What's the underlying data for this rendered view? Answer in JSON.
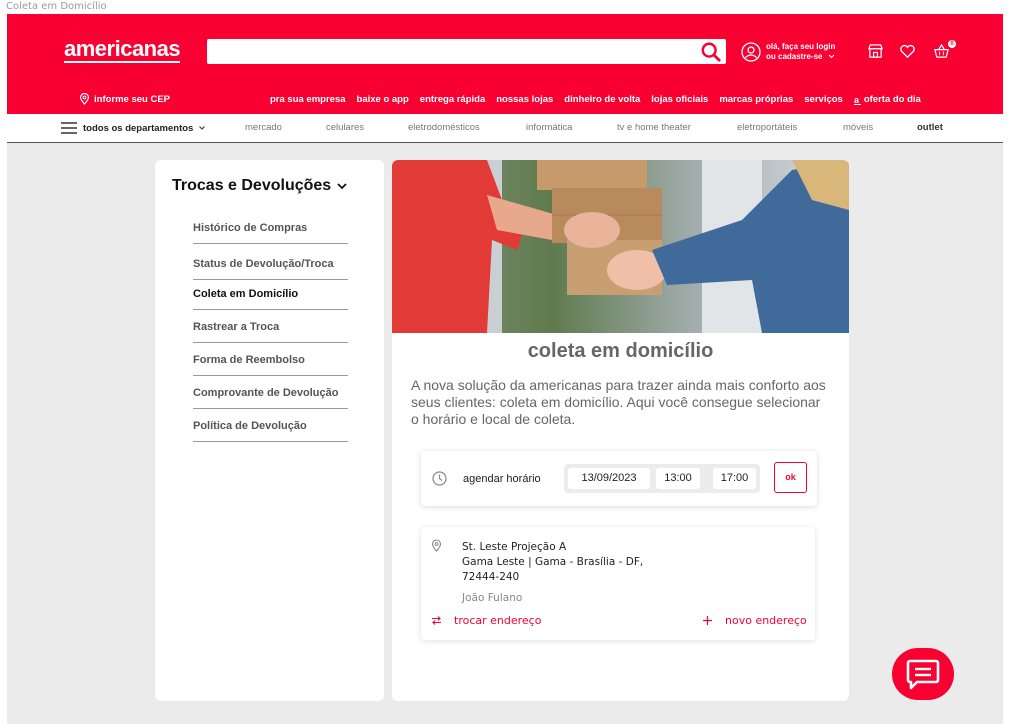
{
  "frame_label": "Coleta em Domicílio",
  "header": {
    "logo": "americanas",
    "search": {
      "value": "",
      "placeholder": ""
    },
    "login": {
      "line1": "olá, faça seu login",
      "line2": "ou cadastre-se"
    },
    "cart_count": "0",
    "cep_label": "informe seu CEP",
    "links": [
      "pra sua empresa",
      "baixe o app",
      "entrega rápida",
      "nossas lojas",
      "dinheiro de volta",
      "lojas oficiais",
      "marcas próprias",
      "serviços",
      "oferta do dia"
    ],
    "accent": "#f80032"
  },
  "dept": {
    "all_label": "todos os departamentos",
    "links": [
      "mercado",
      "celulares",
      "eletrodomésticos",
      "informática",
      "tv e home theater",
      "eletroportáteis",
      "móveis",
      "outlet"
    ]
  },
  "sidebar": {
    "title": "Trocas e Devoluções",
    "items": [
      "Histórico de Compras",
      "Status de Devolução/Troca",
      "Coleta em Domicílio",
      "Rastrear a Troca",
      "Forma de Reembolso",
      "Comprovante de Devolução",
      "Política de Devolução"
    ],
    "active": "Coleta em Domicílio"
  },
  "main": {
    "title": "coleta em domicílio",
    "description": "A nova solução da americanas para trazer ainda mais conforto aos seus clientes: coleta em domicílio. Aqui você consegue selecionar o horário e local de coleta.",
    "schedule": {
      "label": "agendar horário",
      "date": "13/09/2023",
      "start": "13:00",
      "end": "17:00",
      "ok": "ok"
    },
    "address": {
      "line1": "St. Leste Projeção A",
      "line2": "Gama Leste | Gama - Brasília - DF,",
      "line3": "72444-240",
      "name": "João Fulano",
      "change": "trocar endereço",
      "new": "novo endereço"
    }
  },
  "icons": [
    "search-icon",
    "user-icon",
    "store-icon",
    "heart-icon",
    "basket-icon",
    "location-pin-icon",
    "menu-icon",
    "chevron-down-icon",
    "clock-icon",
    "swap-icon",
    "plus-icon",
    "chat-icon"
  ]
}
